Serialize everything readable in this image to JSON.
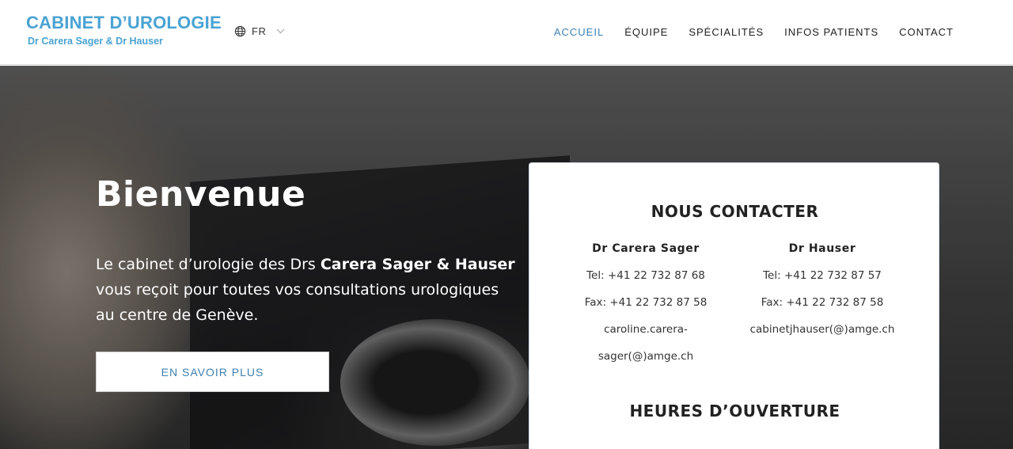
{
  "header": {
    "logo_title": "CABINET D’UROLOGIE",
    "logo_subtitle": "Dr Carera Sager & Dr Hauser",
    "language": "FR",
    "nav": [
      {
        "label": "ACCUEIL"
      },
      {
        "label": "ÉQUIPE"
      },
      {
        "label": "SPÉCIALITÉS"
      },
      {
        "label": "INFOS PATIENTS"
      },
      {
        "label": "CONTACT"
      }
    ],
    "active_color": "#3d7fb0",
    "brand_color": "#4aa3d3"
  },
  "hero": {
    "title": "Bienvenue",
    "text_before": "Le cabinet d’urologie des Drs ",
    "text_bold": "Carera Sager & Hauser",
    "text_after": " vous reçoit pour toutes vos consultations urologiques au centre de Genève.",
    "cta_label": "EN SAVOIR PLUS"
  },
  "contact": {
    "title": "NOUS CONTACTER",
    "doctors": [
      {
        "name": "Dr Carera Sager",
        "tel": "Tel: +41 22 732 87 68",
        "fax": "Fax: +41 22 732 87 58",
        "email": "caroline.carera-sager(@)amge.ch"
      },
      {
        "name": "Dr Hauser",
        "tel": "Tel: +41 22 732 87 57",
        "fax": "Fax: +41 22 732 87 58",
        "email": "cabinetjhauser(@)amge.ch"
      }
    ],
    "hours_title": "HEURES D’OUVERTURE"
  },
  "icons": {
    "language": "globe-icon",
    "dropdown": "chevron-down-icon"
  }
}
